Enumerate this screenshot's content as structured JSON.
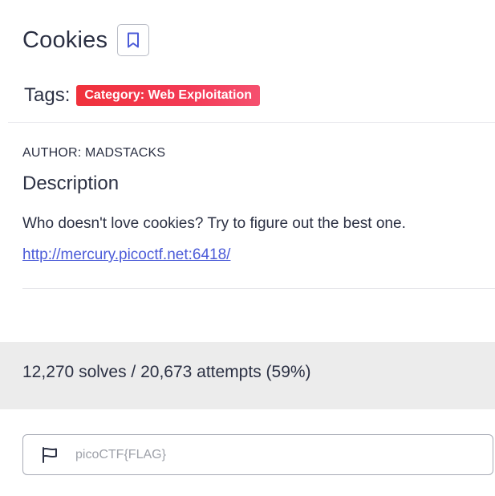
{
  "challenge": {
    "title": "Cookies",
    "bookmark_icon": "bookmark-icon",
    "tags_label": "Tags:",
    "tags": [
      "Category: Web Exploitation"
    ],
    "author": "AUTHOR: MADSTACKS",
    "description_heading": "Description",
    "description_text": "Who doesn't love cookies? Try to figure out the best one.",
    "link": "http://mercury.picoctf.net:6418/"
  },
  "stats": {
    "text": "12,270 solves / 20,673 attempts (59%)"
  },
  "flag_submit": {
    "icon": "flag-icon",
    "placeholder": "picoCTF{FLAG}",
    "value": ""
  },
  "colors": {
    "accent": "#4b5bd8",
    "tag_red": "#f0313b",
    "text": "#2b3043",
    "stats_band": "#ececec"
  }
}
